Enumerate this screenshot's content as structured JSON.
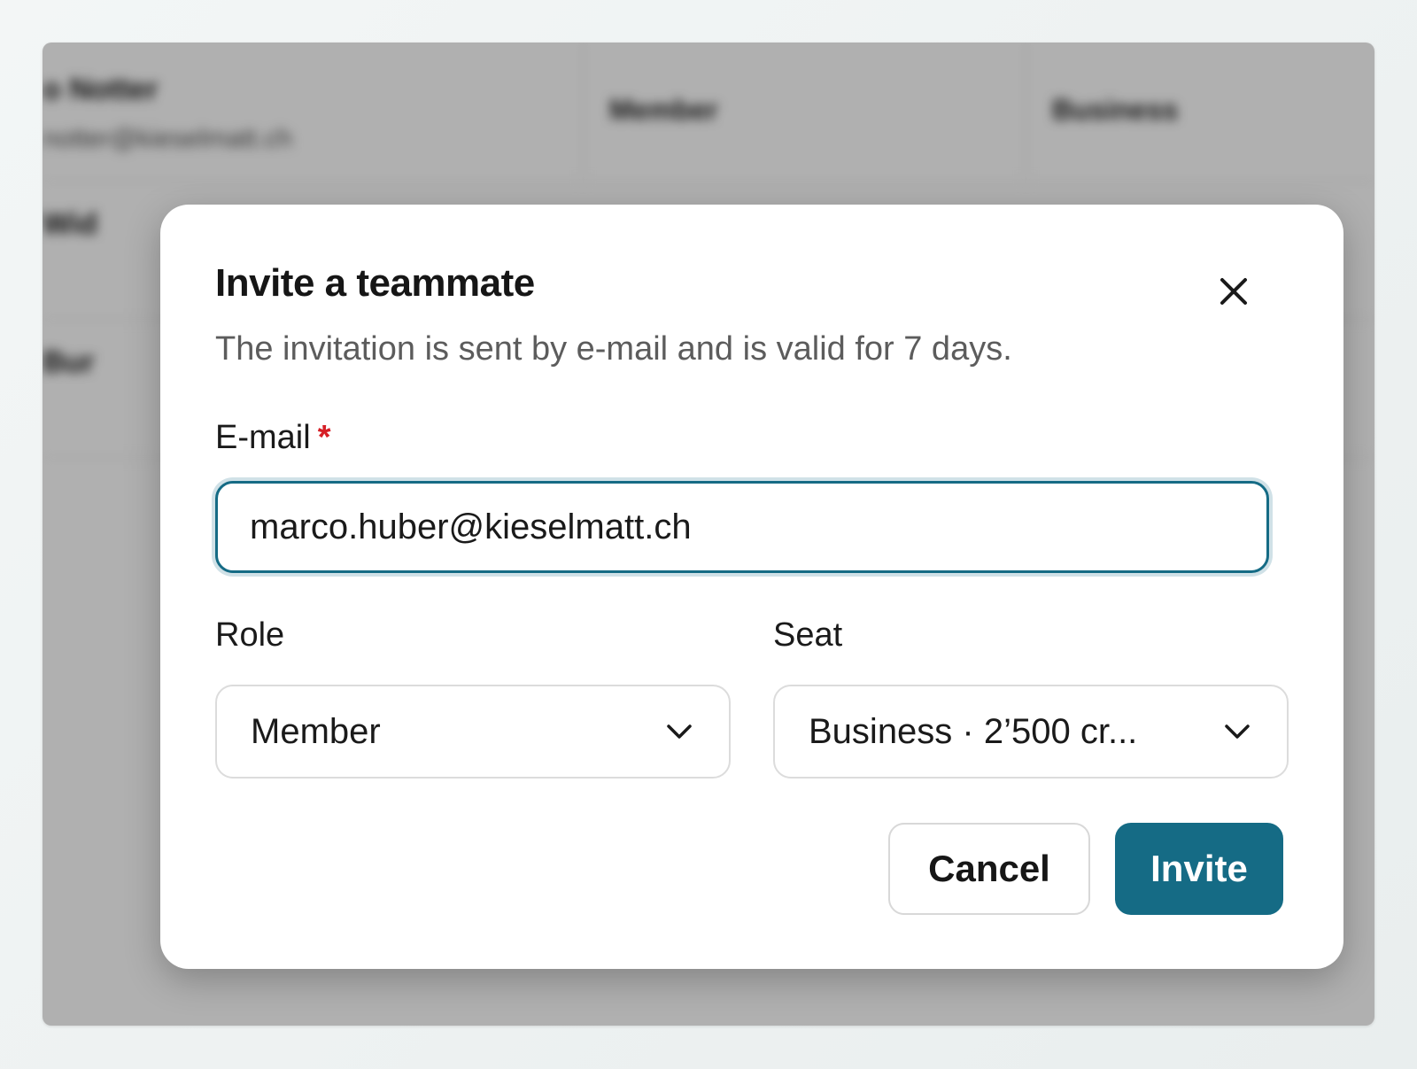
{
  "background": {
    "rows": [
      {
        "name": "o Notter",
        "email": "notter@kieselmatt.ch",
        "role": "Member",
        "seat": "Business"
      },
      {
        "name": "Wid",
        "email": "",
        "role": "",
        "seat": ""
      },
      {
        "name": "Bur",
        "email": "",
        "role": "",
        "seat": ""
      }
    ]
  },
  "modal": {
    "title": "Invite a teammate",
    "subtitle": "The invitation is sent by e-mail and is valid for 7 days.",
    "close_icon": "close-icon",
    "email": {
      "label": "E-mail",
      "required_mark": "*",
      "value": "marco.huber@kieselmatt.ch"
    },
    "role": {
      "label": "Role",
      "value": "Member"
    },
    "seat": {
      "label": "Seat",
      "value": "Business · 2’500 cr..."
    },
    "buttons": {
      "cancel": "Cancel",
      "invite": "Invite"
    }
  },
  "colors": {
    "accent": "#156b85",
    "required": "#d61f26",
    "scrim": "rgba(0,0,0,0.31)"
  }
}
